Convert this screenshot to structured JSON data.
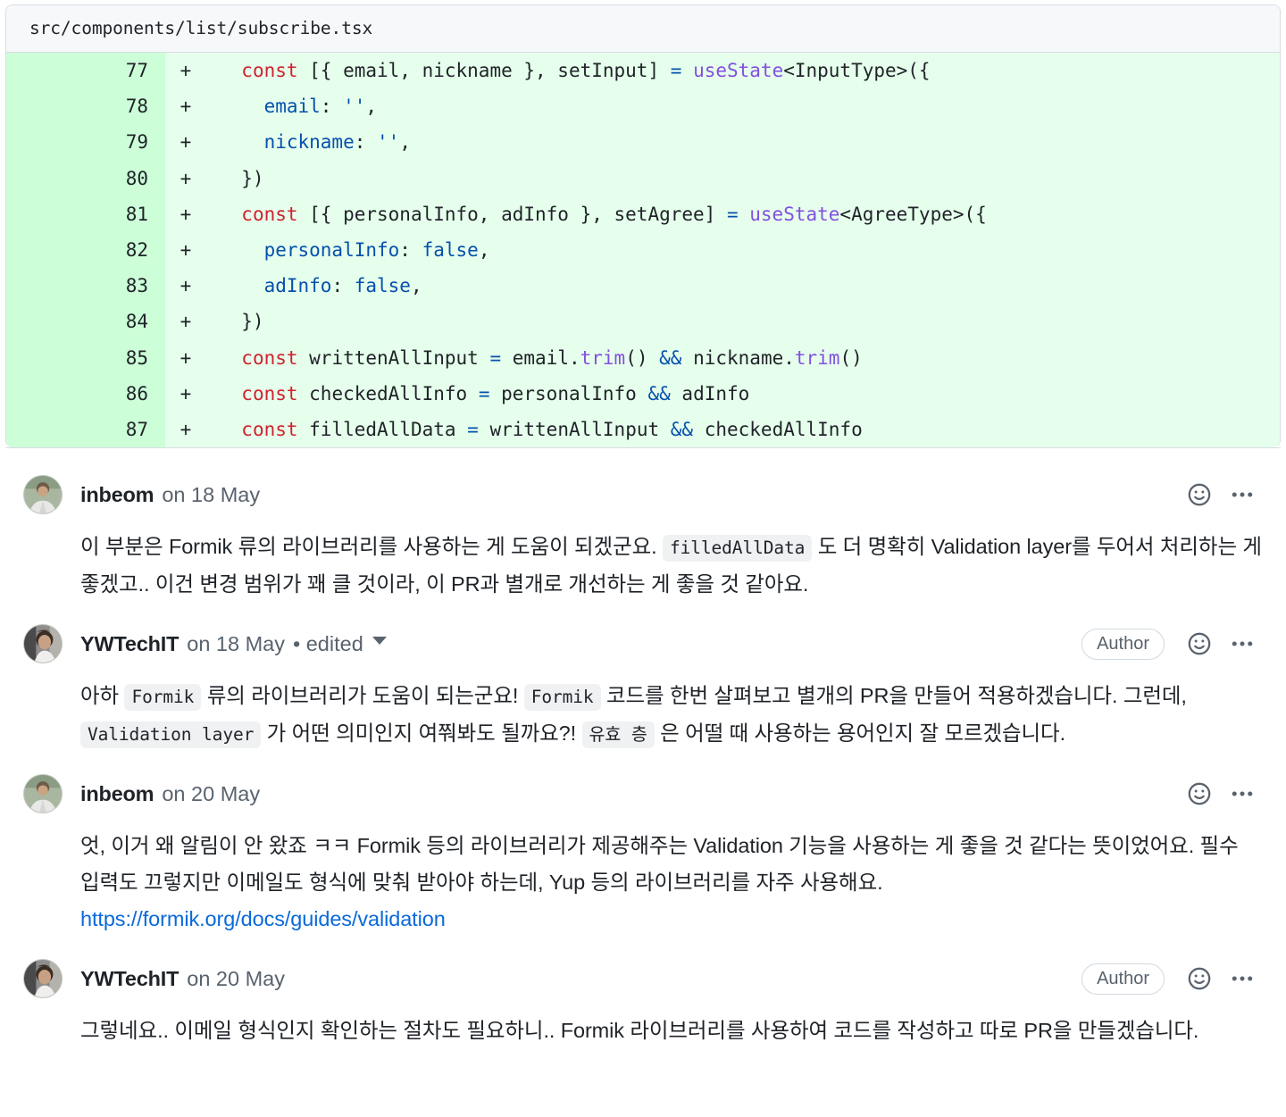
{
  "diff": {
    "file_path": "src/components/list/subscribe.tsx",
    "marker": "+",
    "lines": [
      {
        "number": "77",
        "marker": "+",
        "text": "  const [{ email, nickname }, setInput] = useState<InputType>({"
      },
      {
        "number": "78",
        "marker": "+",
        "text": "    email: '',"
      },
      {
        "number": "79",
        "marker": "+",
        "text": "    nickname: '',"
      },
      {
        "number": "80",
        "marker": "+",
        "text": "  })"
      },
      {
        "number": "81",
        "marker": "+",
        "text": "  const [{ personalInfo, adInfo }, setAgree] = useState<AgreeType>({"
      },
      {
        "number": "82",
        "marker": "+",
        "text": "    personalInfo: false,"
      },
      {
        "number": "83",
        "marker": "+",
        "text": "    adInfo: false,"
      },
      {
        "number": "84",
        "marker": "+",
        "text": "  })"
      },
      {
        "number": "85",
        "marker": "+",
        "text": "  const writtenAllInput = email.trim() && nickname.trim()"
      },
      {
        "number": "86",
        "marker": "+",
        "text": "  const checkedAllInfo = personalInfo && adInfo"
      },
      {
        "number": "87",
        "marker": "+",
        "text": "  const filledAllData = writtenAllInput && checkedAllInfo"
      }
    ]
  },
  "comments": [
    {
      "author": "inbeom",
      "date": "on 18 May",
      "edited": "",
      "is_author_badge": false,
      "author_badge_label": "",
      "body": {
        "seg1": "이 부분은 Formik 류의 라이브러리를 사용하는 게 도움이 되겠군요. ",
        "code1": "filledAllData",
        "seg2": " 도 더 명확히 Validation layer를 두어서 처리하는 게 좋겠고.. 이건 변경 범위가 꽤 클 것이라, 이 PR과 별개로 개선하는 게 좋을 것 같아요."
      }
    },
    {
      "author": "YWTechIT",
      "date": "on 18 May",
      "edited": "• edited",
      "is_author_badge": true,
      "author_badge_label": "Author",
      "body": {
        "seg1": "아하 ",
        "code1": "Formik",
        "seg2": " 류의 라이브러리가 도움이 되는군요! ",
        "code2": "Formik",
        "seg3": " 코드를 한번 살펴보고 별개의 PR을 만들어 적용하겠습니다. 그런데, ",
        "code3": "Validation layer",
        "seg4": " 가 어떤 의미인지 여쭤봐도 될까요?! ",
        "code4": "유효 층",
        "seg5": " 은 어떨 때 사용하는 용어인지 잘 모르겠습니다."
      }
    },
    {
      "author": "inbeom",
      "date": "on 20 May",
      "edited": "",
      "is_author_badge": false,
      "author_badge_label": "",
      "body": {
        "seg1": "엇, 이거 왜 알림이 안 왔죠 ㅋㅋ Formik 등의 라이브러리가 제공해주는 Validation 기능을 사용하는 게 좋을 것 같다는 뜻이었어요. 필수 입력도 끄렇지만 이메일도 형식에 맞춰 받아야 하는데, Yup 등의 라이브러리를 자주 사용해요.",
        "link": "https://formik.org/docs/guides/validation"
      }
    },
    {
      "author": "YWTechIT",
      "date": "on 20 May",
      "edited": "",
      "is_author_badge": true,
      "author_badge_label": "Author",
      "body": {
        "seg1": "그렇네요.. 이메일 형식인지 확인하는 절차도 필요하니.. Formik 라이브러리를 사용하여 코드를 작성하고 따로 PR을 만들겠습니다."
      }
    }
  ],
  "icons": {
    "reaction": "smiley-icon",
    "menu": "kebab-menu-icon",
    "edited_caret": "chevron-down-icon"
  },
  "colors": {
    "diff_add_gutter": "#ccffd8",
    "diff_add_bg": "#e6ffec",
    "link": "#0969da",
    "muted_text": "#59636e",
    "keyword": "#cf222e",
    "function": "#8250df",
    "variable": "#0550ae",
    "border": "#d8dee4",
    "inline_code_bg": "#eff1f3"
  }
}
